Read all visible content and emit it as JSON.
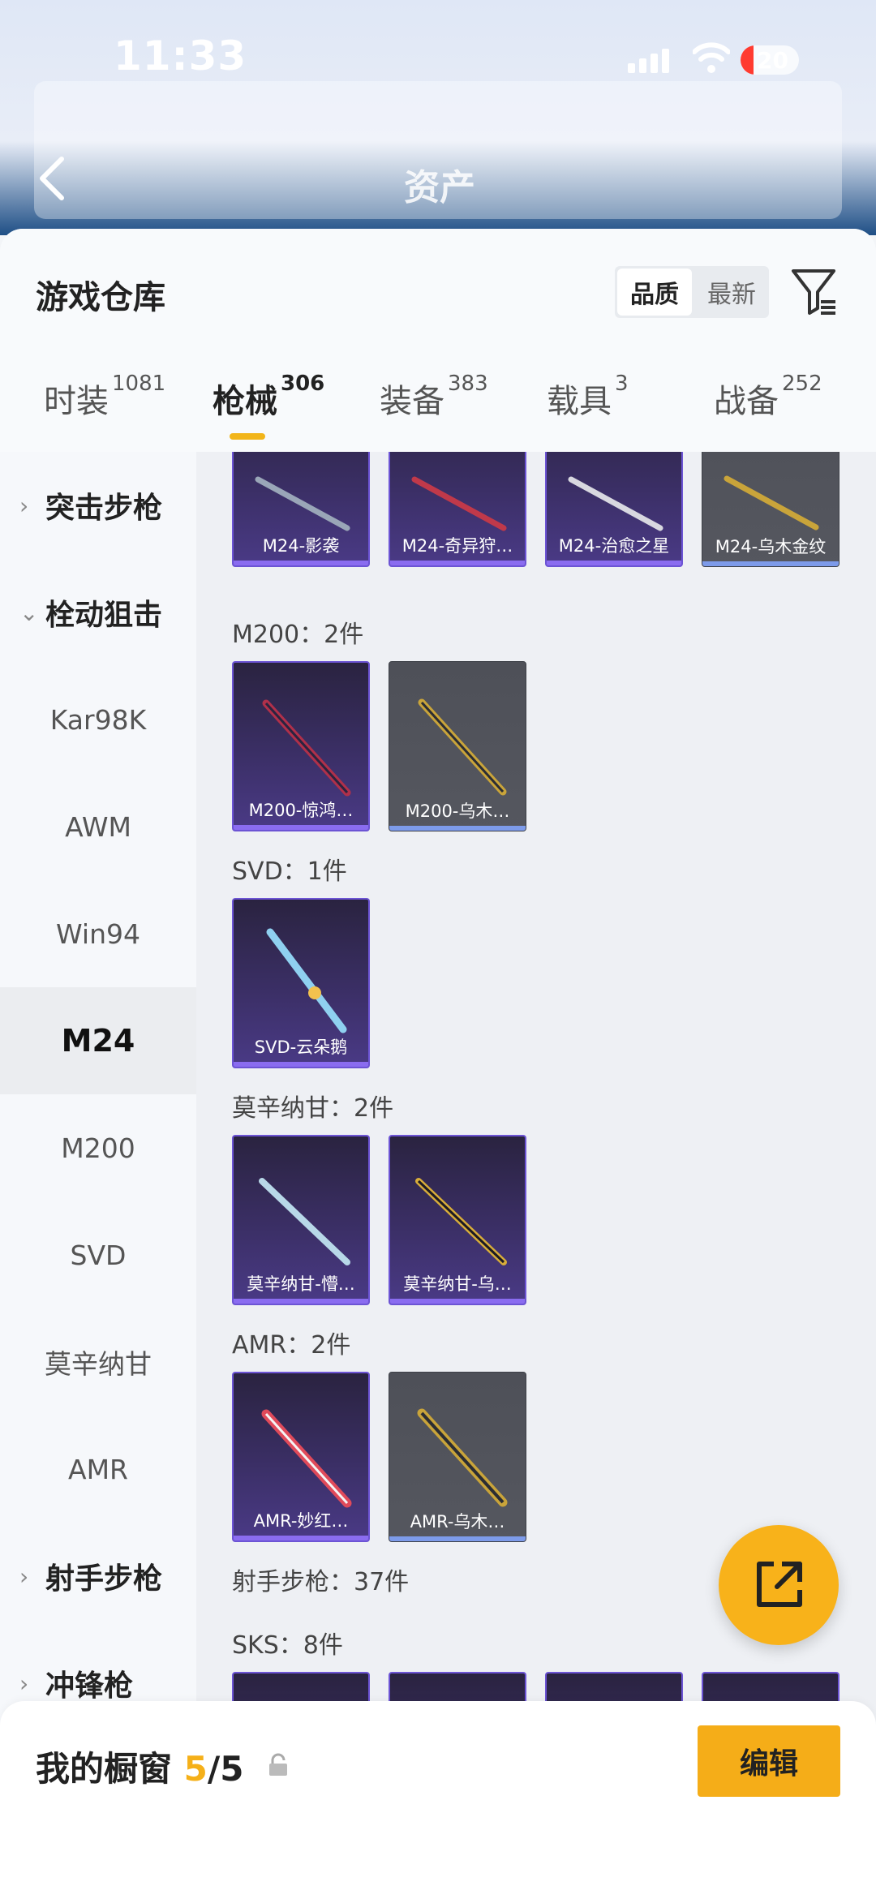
{
  "status": {
    "time": "11:33",
    "battery": "20"
  },
  "header": {
    "title": "资产"
  },
  "warehouse": {
    "title": "游戏仓库",
    "sort_options": [
      "品质",
      "最新"
    ],
    "tabs": [
      {
        "label": "时装",
        "count": "1081"
      },
      {
        "label": "枪械",
        "count": "306"
      },
      {
        "label": "装备",
        "count": "383"
      },
      {
        "label": "载具",
        "count": "3"
      },
      {
        "label": "战备",
        "count": "252"
      }
    ]
  },
  "sidebar": {
    "items": [
      {
        "label": "突击步枪"
      },
      {
        "label": "栓动狙击"
      },
      {
        "label": "Kar98K"
      },
      {
        "label": "AWM"
      },
      {
        "label": "Win94"
      },
      {
        "label": "M24"
      },
      {
        "label": "M200"
      },
      {
        "label": "SVD"
      },
      {
        "label": "莫辛纳甘"
      },
      {
        "label": "AMR"
      },
      {
        "label": "射手步枪"
      },
      {
        "label": "冲锋枪"
      }
    ]
  },
  "content": {
    "m24_items": [
      "M24-影袭",
      "M24-奇异狩…",
      "M24-治愈之星",
      "M24-乌木金纹"
    ],
    "sections": [
      {
        "title": "M200：2件",
        "items": [
          "M200-惊鸿…",
          "M200-乌木…"
        ]
      },
      {
        "title": "SVD：1件",
        "items": [
          "SVD-云朵鹅"
        ]
      },
      {
        "title": "莫辛纳甘：2件",
        "items": [
          "莫辛纳甘-懵…",
          "莫辛纳甘-乌…"
        ]
      },
      {
        "title": "AMR：2件",
        "items": [
          "AMR-妙红…",
          "AMR-乌木…"
        ]
      },
      {
        "title": "射手步枪：37件"
      },
      {
        "title": "SKS：8件"
      }
    ]
  },
  "showcase": {
    "label": "我的橱窗",
    "current": "5",
    "total": "/5"
  },
  "edit_label": "编辑",
  "colors": {
    "accent": "#f5ad18",
    "legendary": "#6c54d4",
    "epic_gray": "#55575f"
  }
}
